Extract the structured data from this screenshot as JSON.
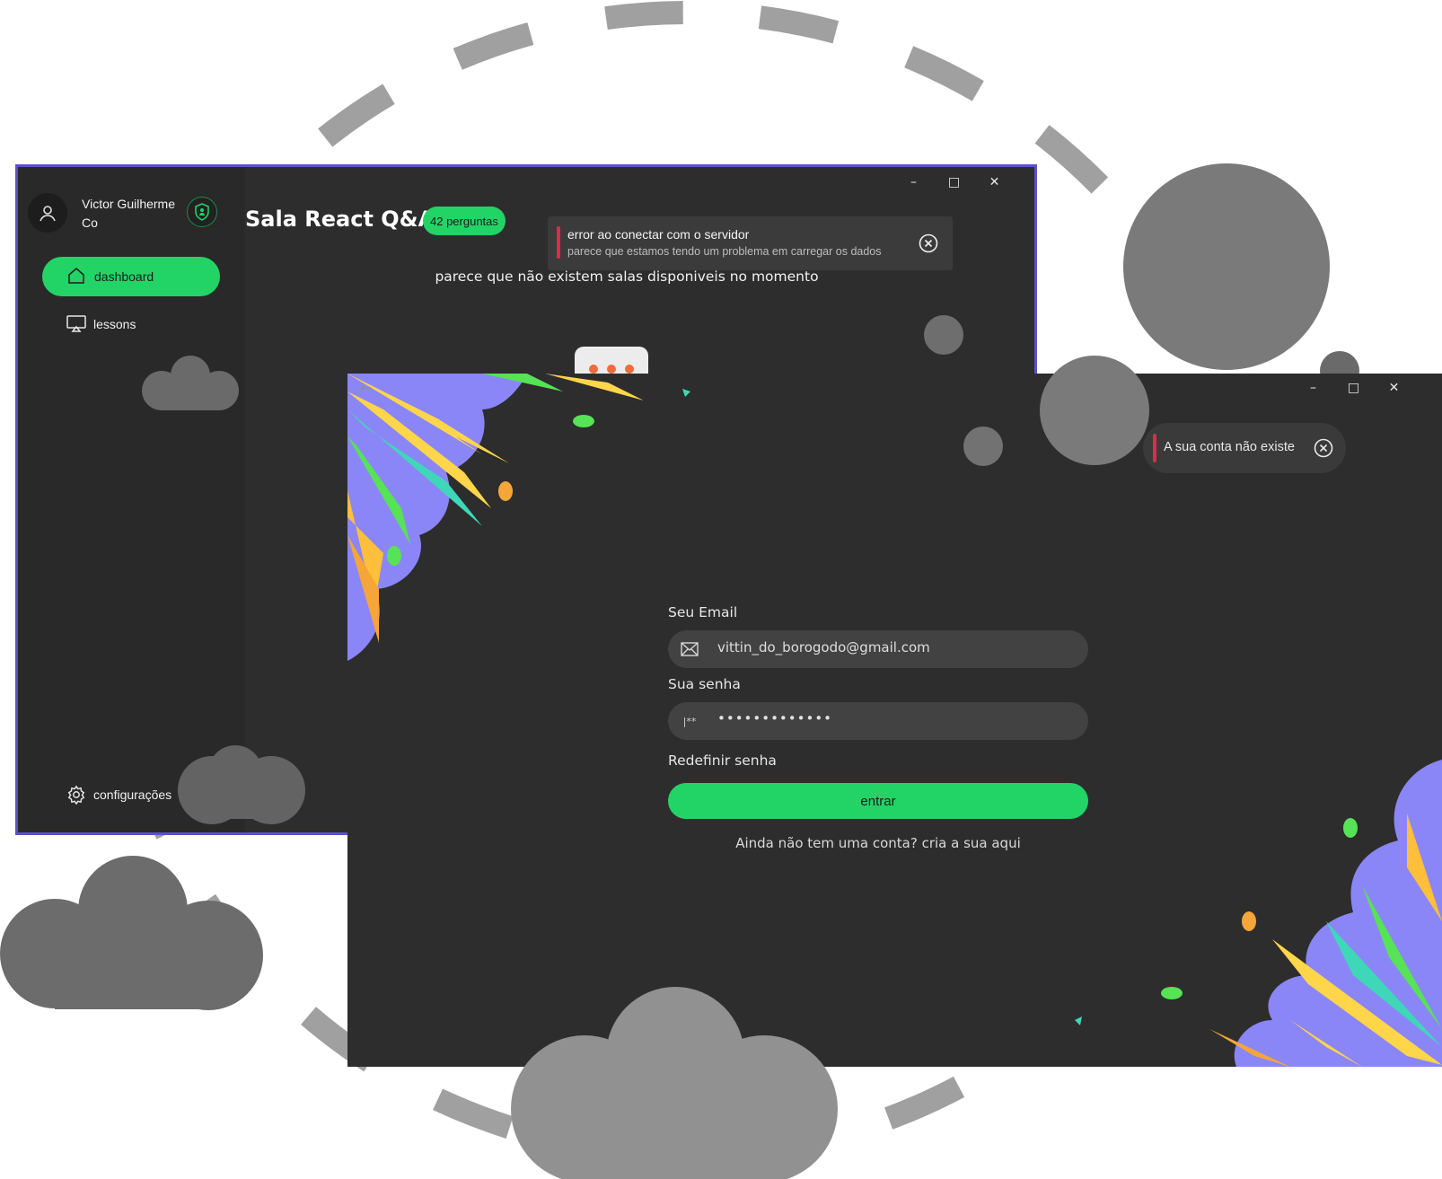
{
  "dashboard_window": {
    "user": {
      "name": "Victor Guilherme Co"
    },
    "nav": {
      "dashboard_label": "dashboard",
      "lessons_label": "lessons",
      "settings_label": "configurações"
    },
    "room": {
      "title": "Sala React Q&A",
      "badge": "42 perguntas"
    },
    "toast": {
      "title": "error ao conectar com o servidor",
      "subtitle": "parece que estamos tendo um problema em carregar os dados"
    },
    "empty_message": "parece que não existem salas disponiveis no momento"
  },
  "login_window": {
    "toast": {
      "message": "A sua conta não existe"
    },
    "email": {
      "label": "Seu Email",
      "value": "vittin_do_borogodo@gmail.com"
    },
    "password": {
      "label": "Sua senha",
      "value": "•••••••••••••",
      "icon_text": "|**"
    },
    "reset_label": "Redefinir senha",
    "submit_label": "entrar",
    "signup_text": "Ainda não tem uma conta? cria a sua aqui"
  },
  "colors": {
    "accent_green": "#22d466",
    "window_border": "#5b52c9",
    "error_red": "#e02a4b",
    "background_dark": "#2d2d2d"
  }
}
